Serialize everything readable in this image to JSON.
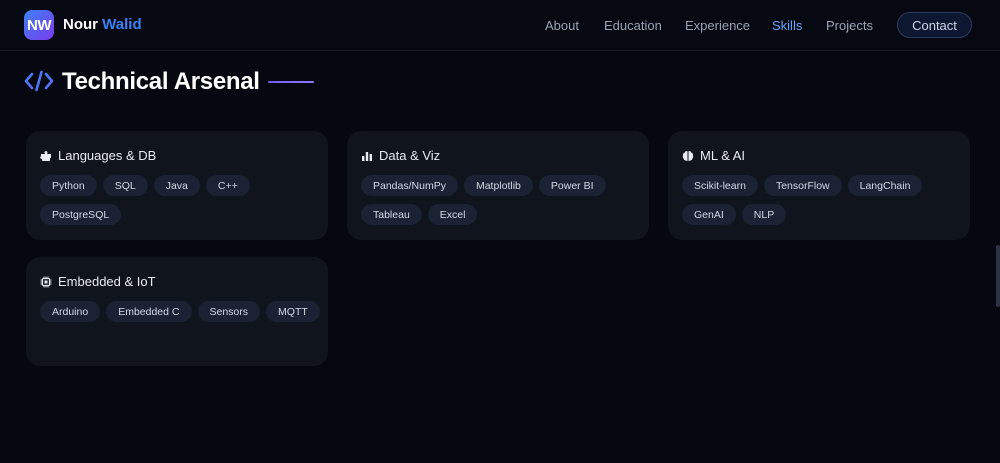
{
  "brand": {
    "initials": "NW",
    "first": "Nour",
    "last": "Walid"
  },
  "nav": {
    "links": [
      "About",
      "Education",
      "Experience",
      "Skills",
      "Projects"
    ],
    "active": "Skills",
    "contact": "Contact"
  },
  "section": {
    "title": "Technical Arsenal",
    "icon": "code-icon"
  },
  "colors": {
    "accent": "#3b82f6",
    "background": "#050810",
    "card": "#0f141d",
    "tag": "#1a2233"
  },
  "cards": [
    {
      "title": "Languages & DB",
      "icon": "puzzle-icon",
      "tags": [
        "Python",
        "SQL",
        "Java",
        "C++",
        "PostgreSQL"
      ]
    },
    {
      "title": "Data & Viz",
      "icon": "bar-chart-icon",
      "tags": [
        "Pandas/NumPy",
        "Matplotlib",
        "Power BI",
        "Tableau",
        "Excel"
      ]
    },
    {
      "title": "ML & AI",
      "icon": "brain-icon",
      "tags": [
        "Scikit-learn",
        "TensorFlow",
        "LangChain",
        "GenAI",
        "NLP"
      ]
    },
    {
      "title": "Embedded & IoT",
      "icon": "chip-icon",
      "tags": [
        "Arduino",
        "Embedded C",
        "Sensors",
        "MQTT"
      ]
    }
  ]
}
